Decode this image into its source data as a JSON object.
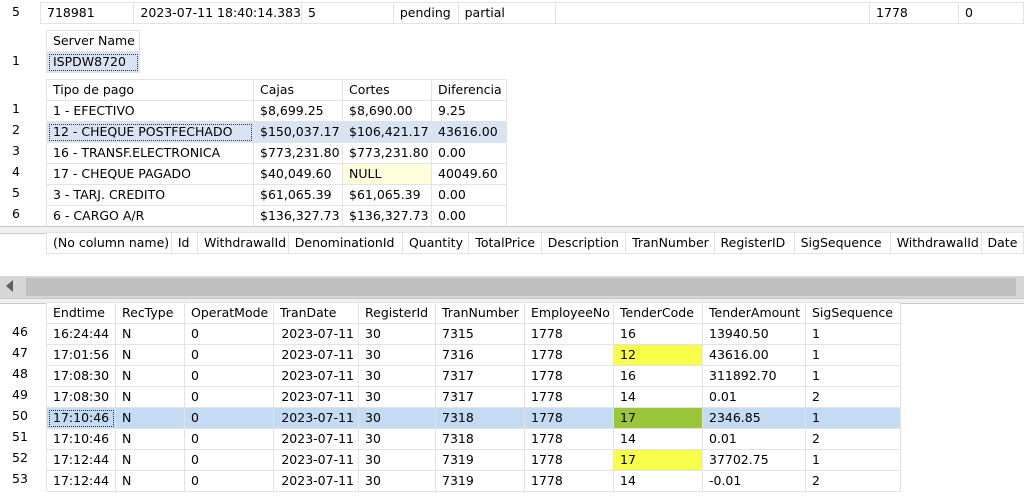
{
  "top_row": {
    "row_num": "5",
    "c1": "718981",
    "c2": "2023-07-11 18:40:14.383",
    "c3": "5",
    "c4": "pending",
    "c5": "partial",
    "c6": "",
    "c7": "1778",
    "c8": "0"
  },
  "server": {
    "header": "Server Name",
    "rows": [
      {
        "n": "1",
        "name": "ISPDW8720"
      }
    ]
  },
  "payments": {
    "headers": [
      "Tipo de pago",
      "Cajas",
      "Cortes",
      "Diferencia"
    ],
    "rows": [
      {
        "n": "1",
        "tipo": "1 - EFECTIVO",
        "cajas": "$8,699.25",
        "cortes": "$8,690.00",
        "dif": "9.25"
      },
      {
        "n": "2",
        "tipo": "12 - CHEQUE POSTFECHADO",
        "cajas": "$150,037.17",
        "cortes": "$106,421.17",
        "dif": "43616.00"
      },
      {
        "n": "3",
        "tipo": "16 - TRANSF.ELECTRONICA",
        "cajas": "$773,231.80",
        "cortes": "$773,231.80",
        "dif": "0.00"
      },
      {
        "n": "4",
        "tipo": "17 - CHEQUE PAGADO",
        "cajas": "$40,049.60",
        "cortes": "NULL",
        "dif": "40049.60"
      },
      {
        "n": "5",
        "tipo": "3 - TARJ. CREDITO",
        "cajas": "$61,065.39",
        "cortes": "$61,065.39",
        "dif": "0.00"
      },
      {
        "n": "6",
        "tipo": "6 - CARGO A/R",
        "cajas": "$136,327.73",
        "cortes": "$136,327.73",
        "dif": "0.00"
      }
    ]
  },
  "empty_grid": {
    "headers": [
      "(No column name)",
      "Id",
      "WithdrawalId",
      "DenominationId",
      "Quantity",
      "TotalPrice",
      "Description",
      "TranNumber",
      "RegisterID",
      "SigSequence",
      "WithdrawalId",
      "Date"
    ]
  },
  "tender": {
    "headers": [
      "Endtime",
      "RecType",
      "OperatMode",
      "TranDate",
      "RegisterId",
      "TranNumber",
      "EmployeeNo",
      "TenderCode",
      "TenderAmount",
      "SigSequence"
    ],
    "rows": [
      {
        "n": "46",
        "v": [
          "16:24:44",
          "N",
          "0",
          "2023-07-11",
          "30",
          "7315",
          "1778",
          "16",
          "13940.50",
          "1"
        ]
      },
      {
        "n": "47",
        "v": [
          "17:01:56",
          "N",
          "0",
          "2023-07-11",
          "30",
          "7316",
          "1778",
          "12",
          "43616.00",
          "1"
        ]
      },
      {
        "n": "48",
        "v": [
          "17:08:30",
          "N",
          "0",
          "2023-07-11",
          "30",
          "7317",
          "1778",
          "16",
          "311892.70",
          "1"
        ]
      },
      {
        "n": "49",
        "v": [
          "17:08:30",
          "N",
          "0",
          "2023-07-11",
          "30",
          "7317",
          "1778",
          "14",
          "0.01",
          "2"
        ]
      },
      {
        "n": "50",
        "v": [
          "17:10:46",
          "N",
          "0",
          "2023-07-11",
          "30",
          "7318",
          "1778",
          "17",
          "2346.85",
          "1"
        ]
      },
      {
        "n": "51",
        "v": [
          "17:10:46",
          "N",
          "0",
          "2023-07-11",
          "30",
          "7318",
          "1778",
          "14",
          "0.01",
          "2"
        ]
      },
      {
        "n": "52",
        "v": [
          "17:12:44",
          "N",
          "0",
          "2023-07-11",
          "30",
          "7319",
          "1778",
          "17",
          "37702.75",
          "1"
        ]
      },
      {
        "n": "53",
        "v": [
          "17:12:44",
          "N",
          "0",
          "2023-07-11",
          "30",
          "7319",
          "1778",
          "14",
          "-0.01",
          "2"
        ]
      }
    ]
  },
  "colors": {
    "highlight": "#f7ff4a",
    "selected_row": "#c3dcf3",
    "null_cell": "#ffffdc"
  }
}
